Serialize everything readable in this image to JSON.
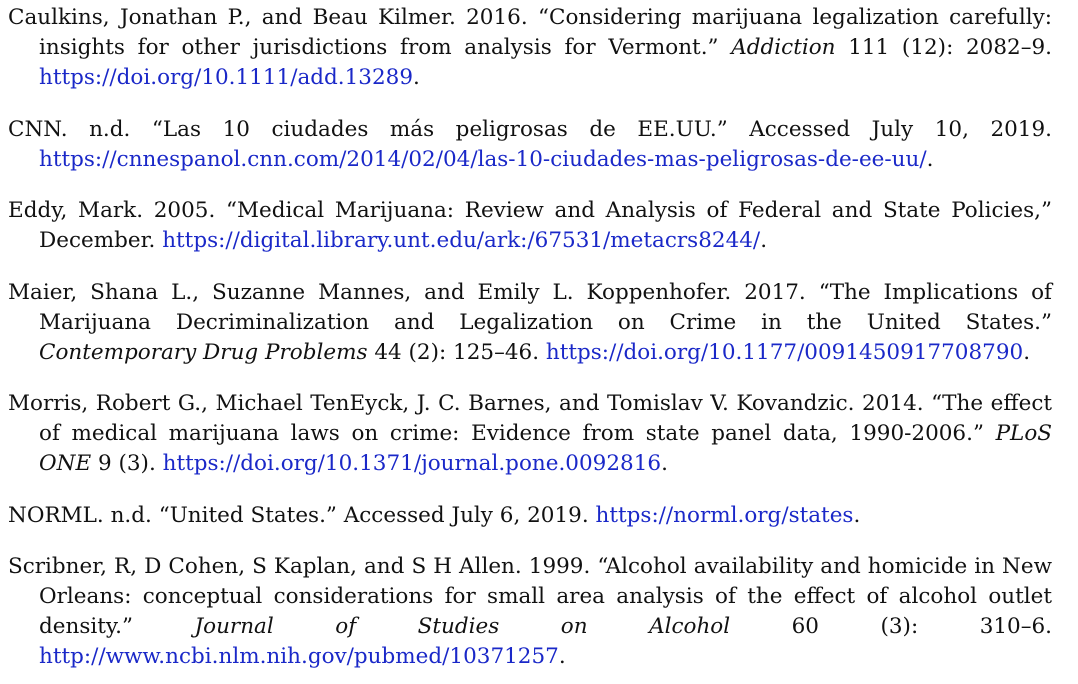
{
  "references": [
    {
      "pre": "Caulkins, Jonathan P., and Beau Kilmer. 2016. “Considering marijuana legalization carefully: insights for other jurisdictions from analysis for Vermont.” ",
      "journal": "Addiction",
      "post": " 111 (12): 2082–9. ",
      "url": "https://doi.org/10.1111/add.13289",
      "tail": "."
    },
    {
      "pre": "CNN. n.d. “Las 10 ciudades más peligrosas de EE.UU.” Accessed July 10, 2019. ",
      "journal": "",
      "post": "",
      "url": "https://cnnespanol.cnn.com/2014/02/04/las-10-ciudades-mas-peligrosas-de-ee-uu/",
      "tail": "."
    },
    {
      "pre": "Eddy, Mark. 2005. “Medical Marijuana: Review and Analysis of Federal and State Policies,” December. ",
      "journal": "",
      "post": "",
      "url": "https://digital.library.unt.edu/ark:/67531/metacrs8244/",
      "tail": "."
    },
    {
      "pre": "Maier, Shana L., Suzanne Mannes, and Emily L. Koppenhofer. 2017. “The Implications of Marijuana Decriminalization and Legalization on Crime in the United States.” ",
      "journal": "Contemporary Drug Problems",
      "post": " 44 (2): 125–46. ",
      "url": "https://doi.org/10.1177/0091450917708790",
      "tail": "."
    },
    {
      "pre": "Morris, Robert G., Michael TenEyck, J. C. Barnes, and Tomislav V. Kovandzic. 2014. “The effect of medical marijuana laws on crime: Evidence from state panel data, 1990-2006.” ",
      "journal": "PLoS ONE",
      "post": " 9 (3). ",
      "url": "https://doi.org/10.1371/journal.pone.0092816",
      "tail": "."
    },
    {
      "pre": "NORML. n.d. “United States.” Accessed July 6, 2019. ",
      "journal": "",
      "post": "",
      "url": "https://norml.org/states",
      "tail": "."
    },
    {
      "pre": "Scribner, R, D Cohen, S Kaplan, and S H Allen. 1999. “Alcohol availability and homicide in New Orleans: conceptual considerations for small area analysis of the effect of alcohol outlet density.” ",
      "journal": "Journal of Studies on Alcohol",
      "post": " 60 (3): 310–6. ",
      "url": "http://www.ncbi.nlm.nih.gov/pubmed/10371257",
      "tail": "."
    }
  ],
  "colors": {
    "text": "#111111",
    "link": "#1a28c8",
    "background": "#ffffff"
  }
}
